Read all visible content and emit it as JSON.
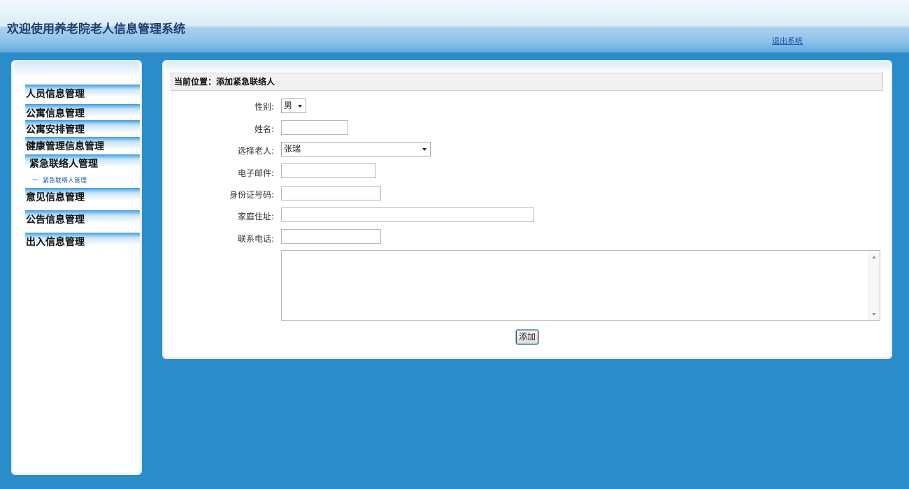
{
  "header": {
    "title": "欢迎使用养老院老人信息管理系统",
    "logout_label": "退出系统"
  },
  "sidebar": {
    "items": [
      {
        "label": "人员信息管理"
      },
      {
        "label": "公寓信息管理"
      },
      {
        "label": "公寓安排管理"
      },
      {
        "label": "健康管理信息管理"
      },
      {
        "label": "紧急联络人管理"
      },
      {
        "label": "意见信息管理"
      },
      {
        "label": "公告信息管理"
      },
      {
        "label": "出入信息管理"
      }
    ],
    "submenu": {
      "dash": "一",
      "label": "紧急联络人管理"
    }
  },
  "main": {
    "breadcrumb": "当前位置：添加紧急联络人",
    "form": {
      "gender_label": "性别:",
      "gender_value": "男",
      "name_label": "姓名:",
      "name_value": "",
      "elder_label": "选择老人:",
      "elder_value": "张瑞",
      "email_label": "电子邮件:",
      "email_value": "",
      "id_label": "身份证号码:",
      "id_value": "",
      "address_label": "家庭住址:",
      "address_value": "",
      "phone_label": "联系电话:",
      "phone_value": "",
      "submit_label": "添加"
    }
  },
  "colors": {
    "background": "#2c8cca",
    "title_text": "#1d3f6e",
    "link": "#1a4fb0"
  }
}
